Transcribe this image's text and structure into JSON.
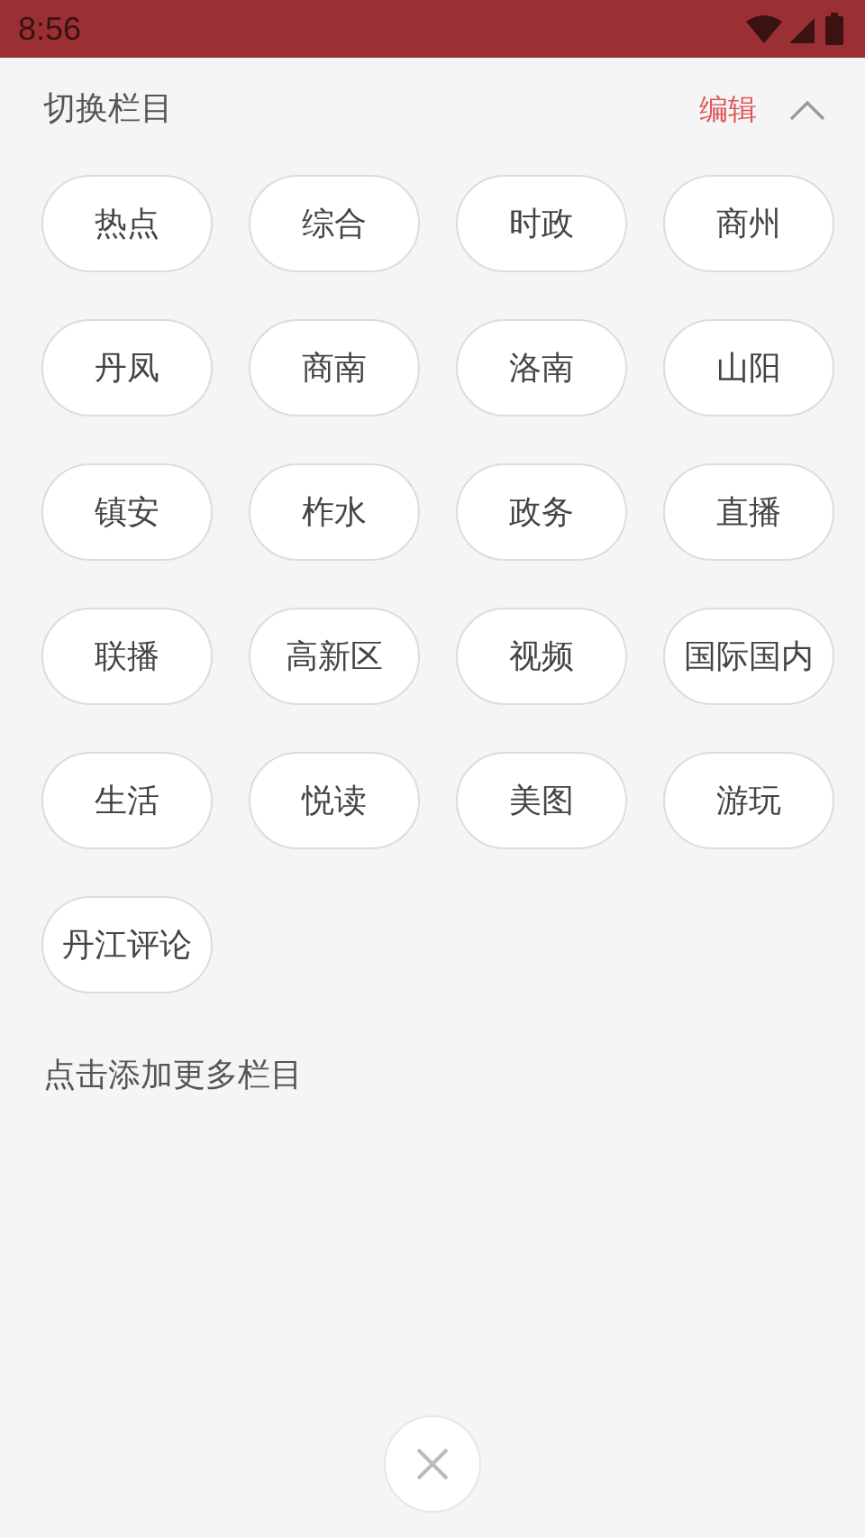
{
  "status_bar": {
    "time": "8:56"
  },
  "header": {
    "title": "切换栏目",
    "edit_label": "编辑",
    "expanded": true
  },
  "channels": [
    {
      "label": "热点"
    },
    {
      "label": "综合"
    },
    {
      "label": "时政"
    },
    {
      "label": "商州"
    },
    {
      "label": "丹凤"
    },
    {
      "label": "商南"
    },
    {
      "label": "洛南"
    },
    {
      "label": "山阳"
    },
    {
      "label": "镇安"
    },
    {
      "label": "柞水"
    },
    {
      "label": "政务"
    },
    {
      "label": "直播"
    },
    {
      "label": "联播"
    },
    {
      "label": "高新区"
    },
    {
      "label": "视频"
    },
    {
      "label": "国际国内"
    },
    {
      "label": "生活"
    },
    {
      "label": "悦读"
    },
    {
      "label": "美图"
    },
    {
      "label": "游玩"
    },
    {
      "label": "丹江评论"
    }
  ],
  "add_more": {
    "label": "点击添加更多栏目"
  }
}
